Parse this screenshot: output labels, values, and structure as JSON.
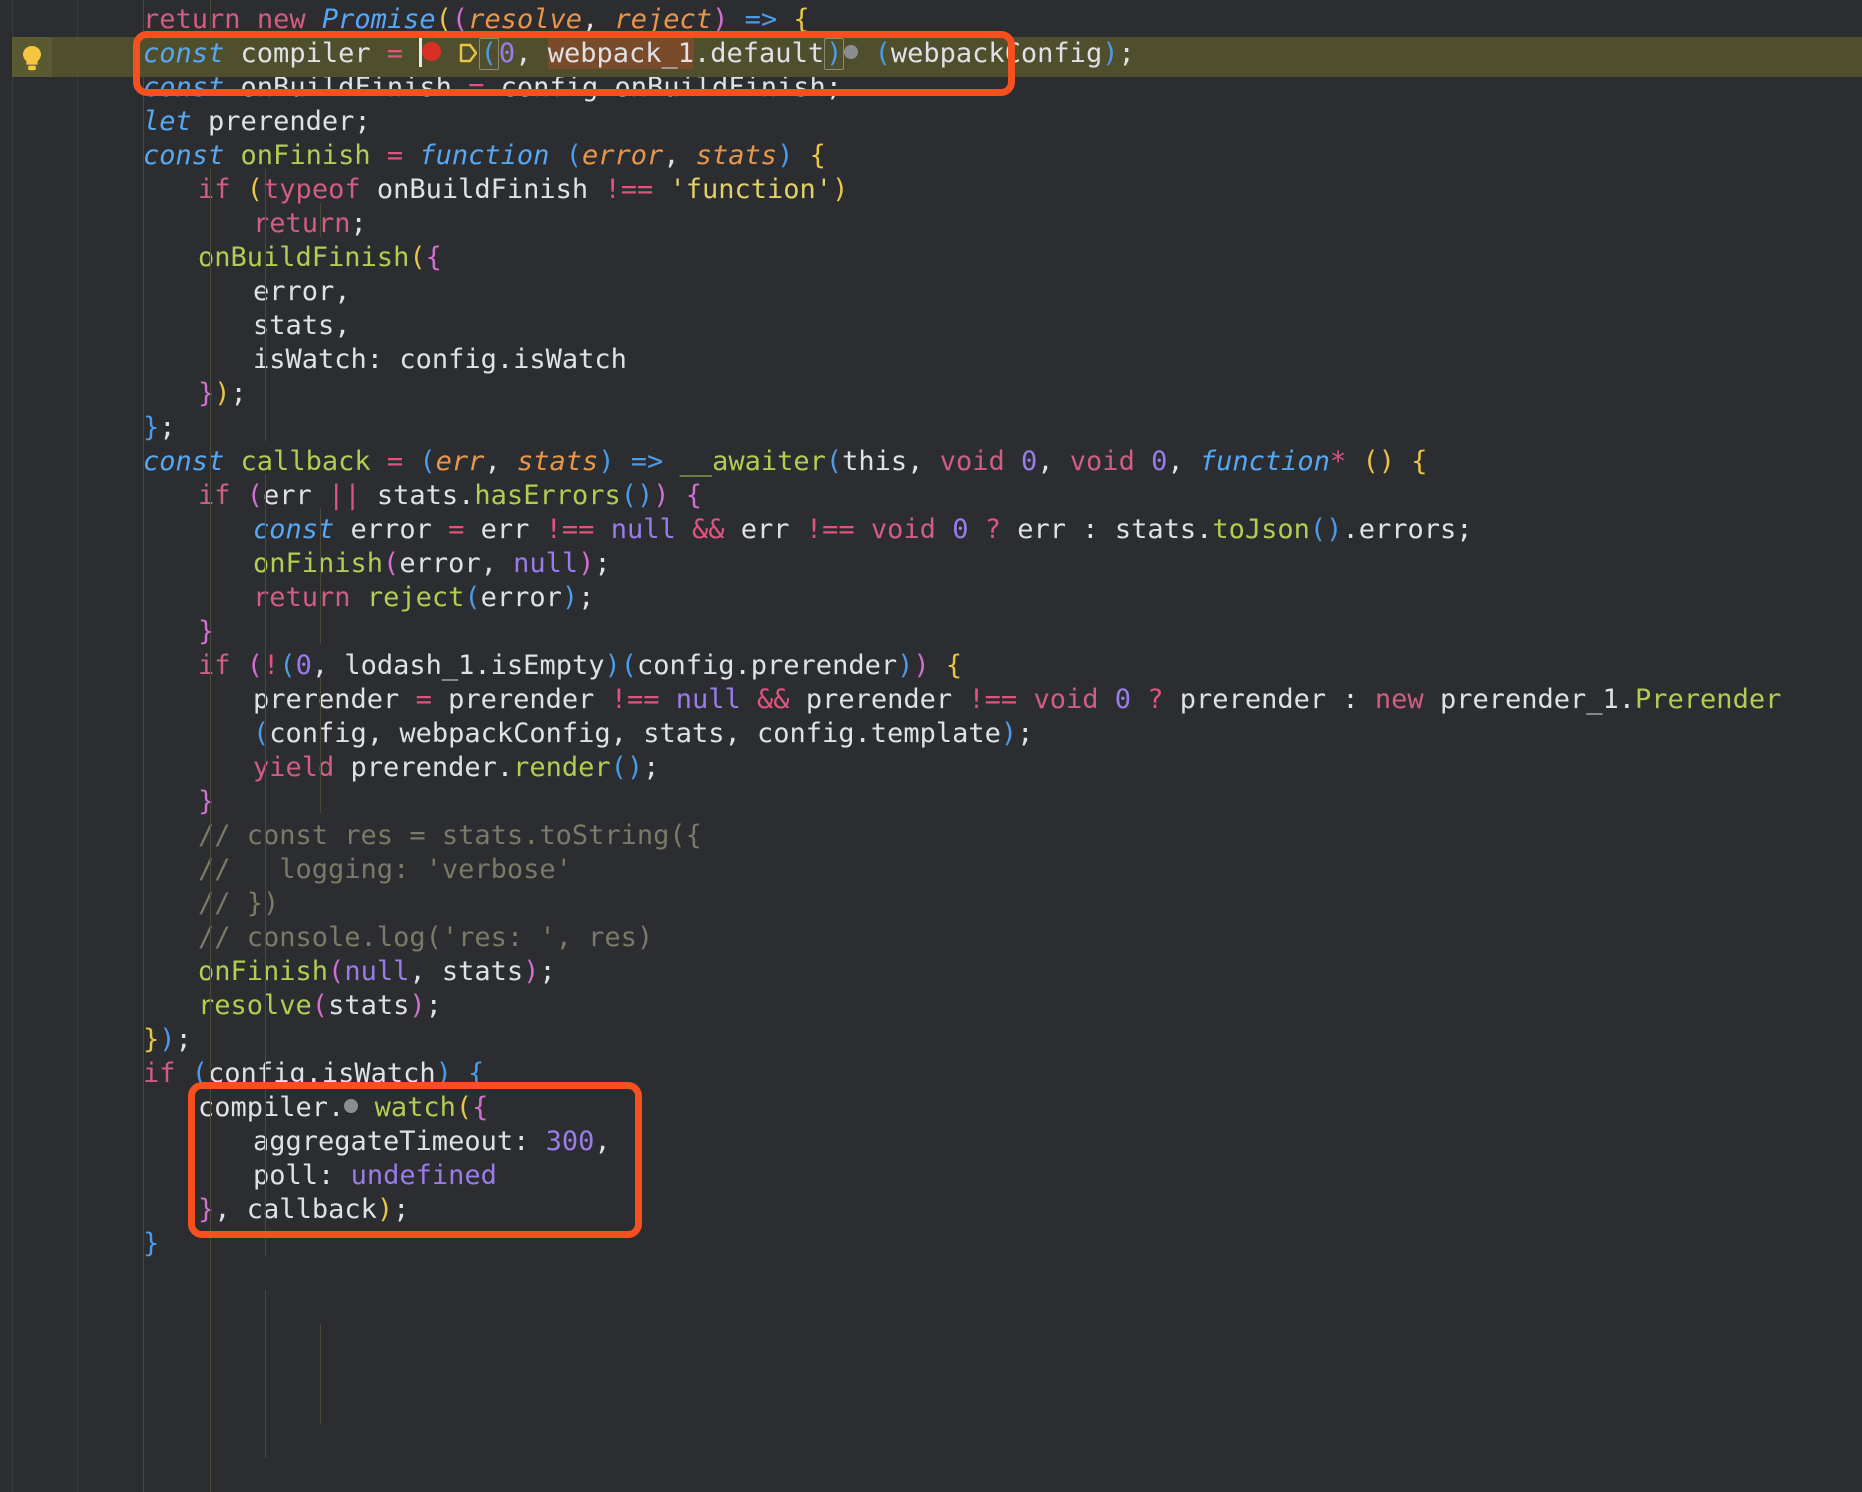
{
  "editor": {
    "name": "code-editor",
    "theme": "dark",
    "background": "#2b2d30",
    "caret_line_background": "#4f4f2e",
    "annotation_color": "#f4511e",
    "language": "javascript"
  },
  "gutter": {
    "lightbulb_icon": "lightbulb-intention-icon",
    "lightbulb_color": "#f5c542"
  },
  "inline_hints": {
    "breakpoint_icon": "red-dot-icon",
    "chevron_icon": "chevron-right-outline-icon",
    "gray_dot_icon": "gray-dot-icon",
    "caret_icon": "text-caret"
  },
  "annotations": [
    {
      "name": "highlight-box-compiler-assignment",
      "label": "const compiler = (0, webpack_1.default)(webpackConfig);"
    },
    {
      "name": "highlight-box-compiler-watch",
      "label": "compiler.watch({ aggregateTimeout: 300, poll: undefined }, callback);"
    }
  ],
  "code_lines": [
    {
      "indent": 1,
      "text": "return new Promise((resolve, reject) => {"
    },
    {
      "indent": 2,
      "text": "const compiler = (0, webpack_1.default)(webpackConfig);",
      "highlighted": true
    },
    {
      "indent": 2,
      "text": "const onBuildFinish = config.onBuildFinish;"
    },
    {
      "indent": 2,
      "text": "let prerender;"
    },
    {
      "indent": 2,
      "text": "const onFinish = function (error, stats) {"
    },
    {
      "indent": 3,
      "text": "if (typeof onBuildFinish !== 'function')"
    },
    {
      "indent": 4,
      "text": "return;"
    },
    {
      "indent": 3,
      "text": "onBuildFinish({"
    },
    {
      "indent": 4,
      "text": "error,"
    },
    {
      "indent": 4,
      "text": "stats,"
    },
    {
      "indent": 4,
      "text": "isWatch: config.isWatch"
    },
    {
      "indent": 3,
      "text": "});"
    },
    {
      "indent": 2,
      "text": "};"
    },
    {
      "indent": 2,
      "text": "const callback = (err, stats) => __awaiter(this, void 0, void 0, function* () {"
    },
    {
      "indent": 3,
      "text": "if (err || stats.hasErrors()) {"
    },
    {
      "indent": 4,
      "text": "const error = err !== null && err !== void 0 ? err : stats.toJson().errors;"
    },
    {
      "indent": 4,
      "text": "onFinish(error, null);"
    },
    {
      "indent": 4,
      "text": "return reject(error);"
    },
    {
      "indent": 3,
      "text": "}"
    },
    {
      "indent": 3,
      "text": "if (!(0, lodash_1.isEmpty)(config.prerender)) {"
    },
    {
      "indent": 4,
      "text": "prerender = prerender !== null && prerender !== void 0 ? prerender : new prerender_1.Prerender"
    },
    {
      "indent": 4,
      "text": "(config, webpackConfig, stats, config.template);"
    },
    {
      "indent": 4,
      "text": "yield prerender.render();"
    },
    {
      "indent": 3,
      "text": "}"
    },
    {
      "indent": 3,
      "text": "// const res = stats.toString({"
    },
    {
      "indent": 3,
      "text": "//   logging: 'verbose'"
    },
    {
      "indent": 3,
      "text": "// })"
    },
    {
      "indent": 3,
      "text": "// console.log('res: ', res)"
    },
    {
      "indent": 3,
      "text": "onFinish(null, stats);"
    },
    {
      "indent": 3,
      "text": "resolve(stats);"
    },
    {
      "indent": 2,
      "text": "});"
    },
    {
      "indent": 2,
      "text": "if (config.isWatch) {"
    },
    {
      "indent": 3,
      "text": "compiler.watch({",
      "boxed": true
    },
    {
      "indent": 4,
      "text": "aggregateTimeout: 300,",
      "boxed": true
    },
    {
      "indent": 4,
      "text": "poll: undefined",
      "boxed": true
    },
    {
      "indent": 3,
      "text": "}, callback);",
      "boxed": true
    },
    {
      "indent": 2,
      "text": "}"
    }
  ],
  "tokens": {
    "keywords": [
      "return",
      "new",
      "if",
      "yield",
      "typeof"
    ],
    "declarations": [
      "const",
      "let",
      "function"
    ],
    "literals": [
      "null",
      "undefined",
      "void",
      "0",
      "300"
    ],
    "strings": [
      "'function'",
      "'verbose'",
      "'res: '"
    ],
    "identifiers": [
      "Promise",
      "resolve",
      "reject",
      "compiler",
      "webpack_1",
      "default",
      "webpackConfig",
      "onBuildFinish",
      "config",
      "prerender",
      "onFinish",
      "error",
      "stats",
      "isWatch",
      "callback",
      "err",
      "__awaiter",
      "this",
      "hasErrors",
      "toJson",
      "errors",
      "lodash_1",
      "isEmpty",
      "prerender_1",
      "Prerender",
      "template",
      "render",
      "watch",
      "aggregateTimeout",
      "poll",
      "res",
      "toString",
      "console",
      "log",
      "logging"
    ]
  },
  "colors": {
    "keyword": "#cf5e82",
    "declaration": "#56a8f5",
    "function_name": "#b3cc51",
    "parameter": "#e8964a",
    "number": "#9a7ce8",
    "string": "#e0d268",
    "operator": "#e0547d",
    "comment": "#7a7a68",
    "text": "#dfe1e5",
    "bracket_yellow": "#e8c547",
    "bracket_magenta": "#d06fd0",
    "bracket_blue": "#4a9be8",
    "usage_highlight": "#7a4b2a"
  }
}
